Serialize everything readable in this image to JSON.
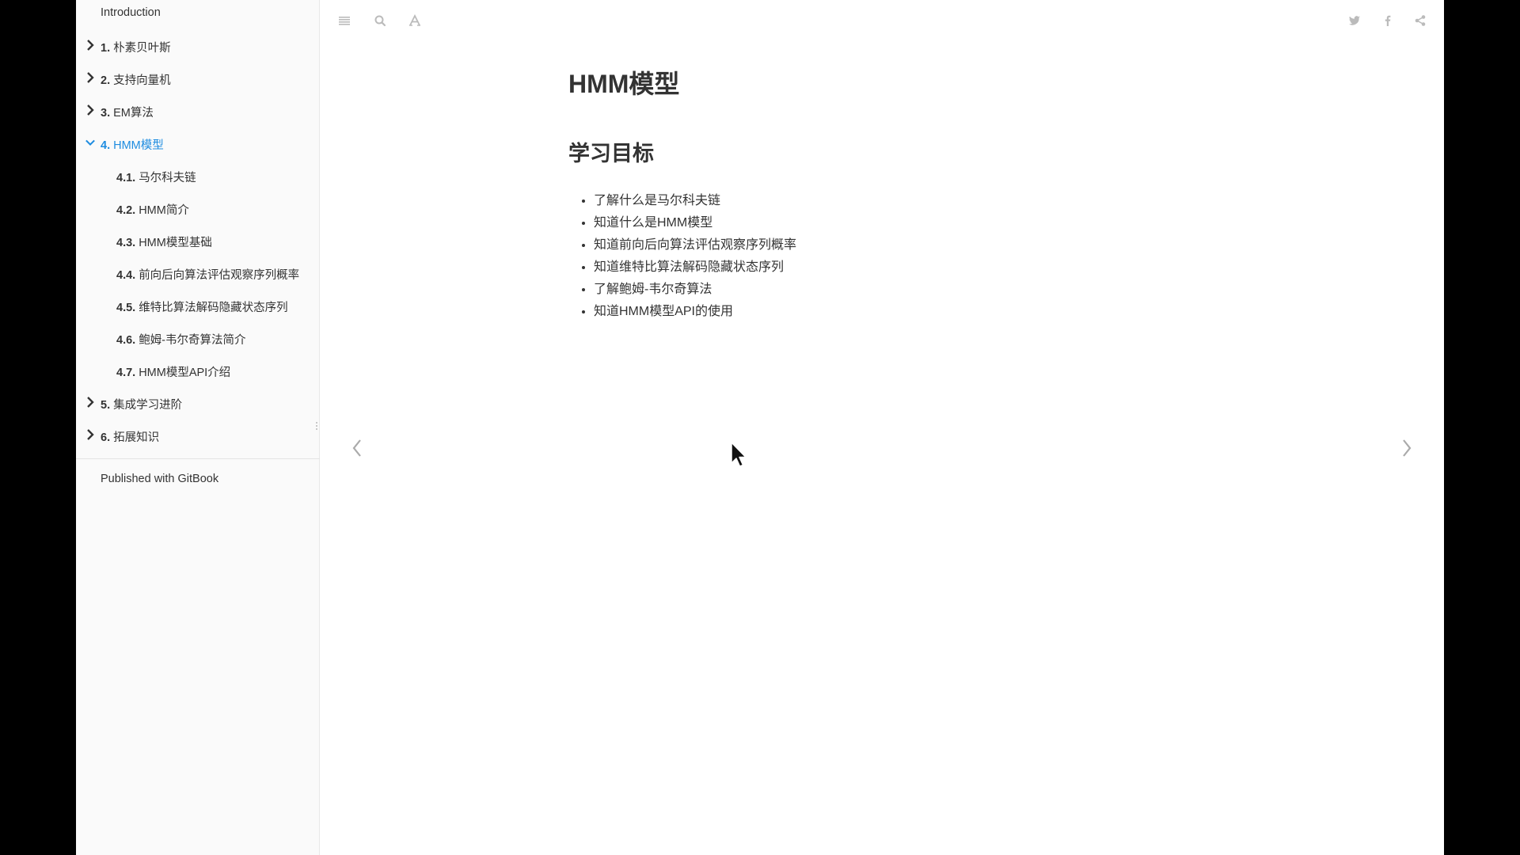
{
  "sidebar": {
    "intro": "Introduction",
    "items": [
      {
        "num": "1.",
        "label": "朴素贝叶斯",
        "expanded": false
      },
      {
        "num": "2.",
        "label": "支持向量机",
        "expanded": false
      },
      {
        "num": "3.",
        "label": "EM算法",
        "expanded": false
      },
      {
        "num": "4.",
        "label": "HMM模型",
        "expanded": true,
        "active": true
      },
      {
        "num": "4.1.",
        "label": "马尔科夫链"
      },
      {
        "num": "4.2.",
        "label": "HMM简介"
      },
      {
        "num": "4.3.",
        "label": "HMM模型基础"
      },
      {
        "num": "4.4.",
        "label": "前向后向算法评估观察序列概率"
      },
      {
        "num": "4.5.",
        "label": "维特比算法解码隐藏状态序列"
      },
      {
        "num": "4.6.",
        "label": "鲍姆-韦尔奇算法简介"
      },
      {
        "num": "4.7.",
        "label": "HMM模型API介绍"
      },
      {
        "num": "5.",
        "label": "集成学习进阶",
        "expanded": false
      },
      {
        "num": "6.",
        "label": "拓展知识",
        "expanded": false
      }
    ],
    "published": "Published with GitBook"
  },
  "toolbar": {
    "left_icons": [
      "menu-icon",
      "search-icon",
      "font-settings-icon"
    ],
    "right_icons": [
      "twitter-icon",
      "facebook-icon",
      "share-icon"
    ]
  },
  "content": {
    "title": "HMM模型",
    "section_title": "学习目标",
    "goals": [
      "了解什么是马尔科夫链",
      "知道什么是HMM模型",
      "知道前向后向算法评估观察序列概率",
      "知道维特比算法解码隐藏状态序列",
      "了解鲍姆-韦尔奇算法",
      "知道HMM模型API的使用"
    ]
  },
  "colors": {
    "active_link": "#1d8ce0",
    "text": "#333333",
    "icon": "#bbbbbb",
    "sidebar_bg": "#fafafa"
  }
}
